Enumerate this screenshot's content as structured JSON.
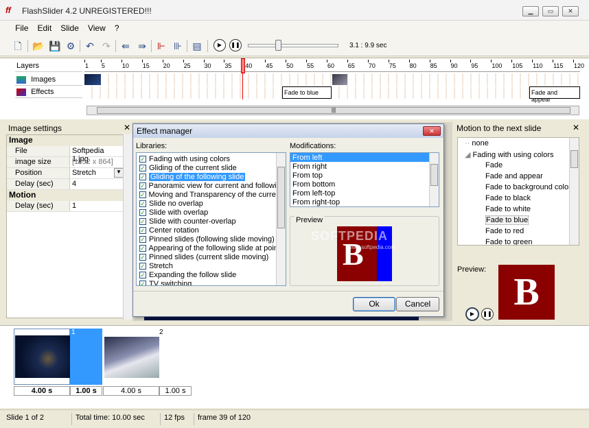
{
  "app": {
    "title": "FlashSlider 4.2 UNREGISTERED!!!"
  },
  "menu": [
    "File",
    "Edit",
    "Slide",
    "View",
    "?"
  ],
  "toolbar": {
    "time_readout": "3.1 : 9.9 sec"
  },
  "timeline": {
    "layers_label": "Layers",
    "images_label": "Images",
    "effects_label": "Effects",
    "ticks": [
      "1",
      "5",
      "10",
      "15",
      "20",
      "25",
      "30",
      "35",
      "40",
      "45",
      "50",
      "55",
      "60",
      "65",
      "70",
      "75",
      "80",
      "85",
      "90",
      "95",
      "100",
      "105",
      "110",
      "115",
      "120"
    ],
    "effects": [
      "Fade to blue",
      "Fade and appear"
    ]
  },
  "image_settings": {
    "title": "Image settings",
    "section_image": "Image",
    "rows": [
      {
        "key": "File",
        "value": "Softpedia 1.jpg"
      },
      {
        "key": "image size",
        "value": "[1152 x 864]"
      },
      {
        "key": "Position",
        "value": "Stretch"
      },
      {
        "key": "Delay (sec)",
        "value": "4"
      }
    ],
    "section_motion": "Motion",
    "motion_rows": [
      {
        "key": "Delay (sec)",
        "value": "1"
      }
    ]
  },
  "dialog": {
    "title": "Effect manager",
    "libraries_label": "Libraries:",
    "modifications_label": "Modifications:",
    "preview_label": "Preview",
    "ok_label": "Ok",
    "cancel_label": "Cancel",
    "libraries": [
      "Fading with using colors",
      "Gliding of the current slide",
      "Gliding of the following slide",
      "Panoramic view for current and following",
      "Moving and Transparency of the current",
      "Slide no overlap",
      "Slide with overlap",
      "Slide with counter-overlap",
      "Center rotation",
      "Pinned slides (following slide moving)",
      "Appearing of the following slide at point",
      "Pinned slides (current slide moving)",
      "Stretch",
      "Expanding the follow slide",
      "TV switching"
    ],
    "modifications": [
      "From left",
      "From right",
      "From top",
      "From bottom",
      "From left-top",
      "From right-top"
    ],
    "watermark": "SOFTPEDIA",
    "watermark_sub": "www.softpedia.com"
  },
  "motion_panel": {
    "title": "Motion to the next slide",
    "tree": [
      {
        "label": "none",
        "level": 0
      },
      {
        "label": "Fading with using colors",
        "level": 0
      },
      {
        "label": "Fade",
        "level": 1
      },
      {
        "label": "Fade and appear",
        "level": 1
      },
      {
        "label": "Fade to background color",
        "level": 1
      },
      {
        "label": "Fade to black",
        "level": 1
      },
      {
        "label": "Fade to white",
        "level": 1
      },
      {
        "label": "Fade to blue",
        "level": 1
      },
      {
        "label": "Fade to red",
        "level": 1
      },
      {
        "label": "Fade to green",
        "level": 1
      }
    ],
    "preview_label": "Preview:",
    "preview_letter": "B"
  },
  "slides": [
    {
      "number": "1",
      "duration": "4.00 s",
      "transition": "1.00 s"
    },
    {
      "number": "2",
      "duration": "4.00 s",
      "transition": "1.00 s"
    }
  ],
  "status": {
    "slide": "Slide 1 of 2",
    "total": "Total time: 10.00 sec",
    "fps": "12 fps",
    "frame": "frame 39 of 120"
  },
  "colors": {
    "accent": "#3399ff",
    "preview_red": "#8b0000",
    "preview_blue": "#0000ff",
    "marker": "#ff6666"
  }
}
